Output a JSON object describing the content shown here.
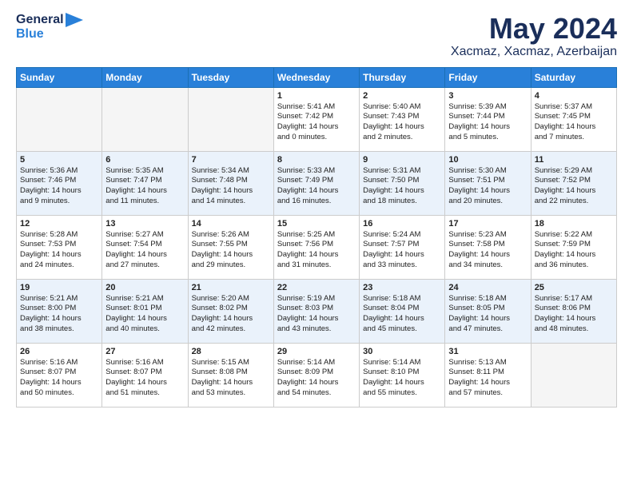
{
  "logo": {
    "line1": "General",
    "line2": "Blue"
  },
  "title": "May 2024",
  "subtitle": "Xacmaz, Xacmaz, Azerbaijan",
  "headers": [
    "Sunday",
    "Monday",
    "Tuesday",
    "Wednesday",
    "Thursday",
    "Friday",
    "Saturday"
  ],
  "weeks": [
    [
      {
        "day": "",
        "info": ""
      },
      {
        "day": "",
        "info": ""
      },
      {
        "day": "",
        "info": ""
      },
      {
        "day": "1",
        "info": "Sunrise: 5:41 AM\nSunset: 7:42 PM\nDaylight: 14 hours\nand 0 minutes."
      },
      {
        "day": "2",
        "info": "Sunrise: 5:40 AM\nSunset: 7:43 PM\nDaylight: 14 hours\nand 2 minutes."
      },
      {
        "day": "3",
        "info": "Sunrise: 5:39 AM\nSunset: 7:44 PM\nDaylight: 14 hours\nand 5 minutes."
      },
      {
        "day": "4",
        "info": "Sunrise: 5:37 AM\nSunset: 7:45 PM\nDaylight: 14 hours\nand 7 minutes."
      }
    ],
    [
      {
        "day": "5",
        "info": "Sunrise: 5:36 AM\nSunset: 7:46 PM\nDaylight: 14 hours\nand 9 minutes."
      },
      {
        "day": "6",
        "info": "Sunrise: 5:35 AM\nSunset: 7:47 PM\nDaylight: 14 hours\nand 11 minutes."
      },
      {
        "day": "7",
        "info": "Sunrise: 5:34 AM\nSunset: 7:48 PM\nDaylight: 14 hours\nand 14 minutes."
      },
      {
        "day": "8",
        "info": "Sunrise: 5:33 AM\nSunset: 7:49 PM\nDaylight: 14 hours\nand 16 minutes."
      },
      {
        "day": "9",
        "info": "Sunrise: 5:31 AM\nSunset: 7:50 PM\nDaylight: 14 hours\nand 18 minutes."
      },
      {
        "day": "10",
        "info": "Sunrise: 5:30 AM\nSunset: 7:51 PM\nDaylight: 14 hours\nand 20 minutes."
      },
      {
        "day": "11",
        "info": "Sunrise: 5:29 AM\nSunset: 7:52 PM\nDaylight: 14 hours\nand 22 minutes."
      }
    ],
    [
      {
        "day": "12",
        "info": "Sunrise: 5:28 AM\nSunset: 7:53 PM\nDaylight: 14 hours\nand 24 minutes."
      },
      {
        "day": "13",
        "info": "Sunrise: 5:27 AM\nSunset: 7:54 PM\nDaylight: 14 hours\nand 27 minutes."
      },
      {
        "day": "14",
        "info": "Sunrise: 5:26 AM\nSunset: 7:55 PM\nDaylight: 14 hours\nand 29 minutes."
      },
      {
        "day": "15",
        "info": "Sunrise: 5:25 AM\nSunset: 7:56 PM\nDaylight: 14 hours\nand 31 minutes."
      },
      {
        "day": "16",
        "info": "Sunrise: 5:24 AM\nSunset: 7:57 PM\nDaylight: 14 hours\nand 33 minutes."
      },
      {
        "day": "17",
        "info": "Sunrise: 5:23 AM\nSunset: 7:58 PM\nDaylight: 14 hours\nand 34 minutes."
      },
      {
        "day": "18",
        "info": "Sunrise: 5:22 AM\nSunset: 7:59 PM\nDaylight: 14 hours\nand 36 minutes."
      }
    ],
    [
      {
        "day": "19",
        "info": "Sunrise: 5:21 AM\nSunset: 8:00 PM\nDaylight: 14 hours\nand 38 minutes."
      },
      {
        "day": "20",
        "info": "Sunrise: 5:21 AM\nSunset: 8:01 PM\nDaylight: 14 hours\nand 40 minutes."
      },
      {
        "day": "21",
        "info": "Sunrise: 5:20 AM\nSunset: 8:02 PM\nDaylight: 14 hours\nand 42 minutes."
      },
      {
        "day": "22",
        "info": "Sunrise: 5:19 AM\nSunset: 8:03 PM\nDaylight: 14 hours\nand 43 minutes."
      },
      {
        "day": "23",
        "info": "Sunrise: 5:18 AM\nSunset: 8:04 PM\nDaylight: 14 hours\nand 45 minutes."
      },
      {
        "day": "24",
        "info": "Sunrise: 5:18 AM\nSunset: 8:05 PM\nDaylight: 14 hours\nand 47 minutes."
      },
      {
        "day": "25",
        "info": "Sunrise: 5:17 AM\nSunset: 8:06 PM\nDaylight: 14 hours\nand 48 minutes."
      }
    ],
    [
      {
        "day": "26",
        "info": "Sunrise: 5:16 AM\nSunset: 8:07 PM\nDaylight: 14 hours\nand 50 minutes."
      },
      {
        "day": "27",
        "info": "Sunrise: 5:16 AM\nSunset: 8:07 PM\nDaylight: 14 hours\nand 51 minutes."
      },
      {
        "day": "28",
        "info": "Sunrise: 5:15 AM\nSunset: 8:08 PM\nDaylight: 14 hours\nand 53 minutes."
      },
      {
        "day": "29",
        "info": "Sunrise: 5:14 AM\nSunset: 8:09 PM\nDaylight: 14 hours\nand 54 minutes."
      },
      {
        "day": "30",
        "info": "Sunrise: 5:14 AM\nSunset: 8:10 PM\nDaylight: 14 hours\nand 55 minutes."
      },
      {
        "day": "31",
        "info": "Sunrise: 5:13 AM\nSunset: 8:11 PM\nDaylight: 14 hours\nand 57 minutes."
      },
      {
        "day": "",
        "info": ""
      }
    ]
  ]
}
